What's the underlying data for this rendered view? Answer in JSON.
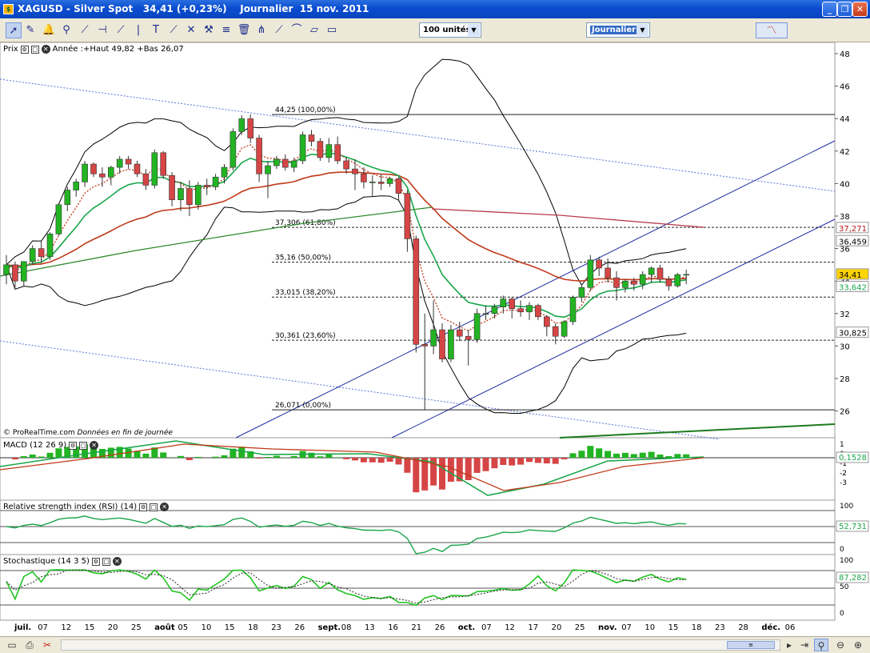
{
  "window": {
    "title_symbol": "XAGUSD - Silver Spot",
    "title_price": "34,41 (+0,23%)",
    "title_period": "Journalier",
    "title_date": "15 nov. 2011",
    "icon": "prorealtime-app-icon",
    "buttons": [
      "minimize",
      "restore",
      "close"
    ]
  },
  "toolbar": {
    "tools": [
      "pointer-icon",
      "ruler-icon",
      "alarm-bell-icon",
      "zoom-icon",
      "trendline-icon",
      "horizontal-line-icon",
      "ray-icon",
      "vertical-line-icon",
      "text-icon",
      "crosshair-icon",
      "arrow-icon",
      "hammer-icon",
      "fibonacci-icon",
      "trash-icon",
      "fibo-fan-icon",
      "regression-channel-icon",
      "fibo-arc-icon",
      "parallel-channel-icon",
      "rectangle-icon"
    ],
    "units_select": "100 unités",
    "period_select": "Journalier",
    "indicator_button_icon": "indicator-chart-icon"
  },
  "price_panel": {
    "label": "Prix",
    "annual_info": "Année :+Haut 49,82 +Bas 26,07",
    "copyright": "© ProRealTime.com",
    "data_note": "Données en fin de journée",
    "y_ticks": [
      "48",
      "46",
      "44",
      "42",
      "40",
      "38",
      "36",
      "34",
      "32",
      "30",
      "28",
      "26"
    ],
    "last_price": "34,41",
    "tags": {
      "red_ma": "37,271",
      "upper_band": "36,459",
      "green_ma": "33,642",
      "lower_band": "30,825"
    },
    "fibo_levels": [
      {
        "label": "44,25 (100,00%)",
        "value": 44.25
      },
      {
        "label": "37,306 (61,80%)",
        "value": 37.306
      },
      {
        "label": "35,16 (50,00%)",
        "value": 35.16
      },
      {
        "label": "33,015 (38,20%)",
        "value": 33.015
      },
      {
        "label": "30,361 (23,60%)",
        "value": 30.361
      },
      {
        "label": "26,071 (0,00%)",
        "value": 26.071
      }
    ],
    "colors": {
      "up": "#22b422",
      "down": "#d64545",
      "ma_red": "#c03a1a",
      "ma_green": "#1aa64a",
      "ma_long_green": "#2e8a2e",
      "ma_long_red": "#b83a4a",
      "channel": "#1c2aa0",
      "band": "#000000"
    }
  },
  "macd_panel": {
    "label": "MACD (12 26 9)",
    "y_ticks": [
      "1",
      "0",
      "-1",
      "-2",
      "-3"
    ],
    "value": "0,1528"
  },
  "rsi_panel": {
    "label": "Relative strength index (RSI) (14)",
    "y_ticks": [
      "100",
      "50",
      "0"
    ],
    "value": "52,731"
  },
  "stoch_panel": {
    "label": "Stochastique (14 3 5)",
    "y_ticks": [
      "100",
      "50",
      "0"
    ],
    "value": "87,282"
  },
  "x_axis": {
    "labels": [
      "juil.",
      "07",
      "12",
      "15",
      "20",
      "25",
      "août",
      "05",
      "10",
      "15",
      "18",
      "23",
      "26",
      "sept.",
      "08",
      "13",
      "16",
      "21",
      "26",
      "oct.",
      "07",
      "12",
      "17",
      "20",
      "25",
      "nov.",
      "07",
      "10",
      "15",
      "18",
      "23",
      "28",
      "déc.",
      "06"
    ],
    "bold": [
      "juil.",
      "août",
      "sept.",
      "oct.",
      "nov.",
      "déc."
    ]
  },
  "chart_data": {
    "type": "candlestick",
    "title": "XAGUSD - Silver Spot",
    "ylim": [
      25,
      49
    ],
    "series": [
      {
        "name": "XAGUSD",
        "ohlc": [
          [
            34.4,
            35.6,
            33.8,
            35.0
          ],
          [
            35.0,
            35.2,
            33.6,
            34.0
          ],
          [
            34.0,
            35.2,
            33.7,
            35.2
          ],
          [
            35.2,
            36.2,
            35.0,
            36.0
          ],
          [
            36.0,
            36.5,
            35.1,
            35.5
          ],
          [
            35.5,
            37.0,
            35.3,
            36.9
          ],
          [
            36.9,
            38.8,
            36.8,
            38.7
          ],
          [
            38.7,
            39.8,
            38.3,
            39.6
          ],
          [
            39.6,
            40.3,
            39.2,
            40.1
          ],
          [
            40.1,
            41.4,
            39.8,
            41.2
          ],
          [
            41.2,
            41.3,
            40.4,
            40.6
          ],
          [
            40.6,
            41.0,
            39.8,
            40.4
          ],
          [
            40.4,
            41.1,
            39.9,
            41.0
          ],
          [
            41.0,
            41.7,
            40.6,
            41.5
          ],
          [
            41.5,
            41.7,
            40.9,
            41.2
          ],
          [
            41.2,
            41.4,
            40.4,
            40.6
          ],
          [
            40.6,
            40.9,
            39.6,
            39.9
          ],
          [
            39.9,
            42.1,
            39.7,
            41.9
          ],
          [
            41.9,
            42.0,
            40.3,
            40.5
          ],
          [
            40.5,
            40.7,
            38.6,
            39.0
          ],
          [
            39.0,
            40.1,
            38.3,
            39.7
          ],
          [
            39.7,
            40.2,
            38.0,
            38.7
          ],
          [
            38.7,
            40.1,
            38.4,
            39.9
          ],
          [
            39.9,
            40.3,
            39.3,
            39.8
          ],
          [
            39.8,
            40.6,
            39.6,
            40.4
          ],
          [
            40.4,
            41.2,
            40.0,
            41.0
          ],
          [
            41.0,
            43.4,
            40.8,
            43.2
          ],
          [
            43.2,
            44.2,
            43.0,
            44.0
          ],
          [
            44.0,
            44.25,
            42.5,
            42.8
          ],
          [
            42.8,
            43.0,
            40.1,
            40.6
          ],
          [
            40.6,
            41.4,
            39.1,
            41.1
          ],
          [
            41.1,
            41.7,
            40.9,
            41.5
          ],
          [
            41.5,
            41.8,
            40.8,
            41.0
          ],
          [
            41.0,
            41.6,
            40.7,
            41.4
          ],
          [
            41.4,
            43.2,
            41.2,
            43.0
          ],
          [
            43.0,
            43.3,
            42.3,
            42.6
          ],
          [
            42.6,
            42.8,
            41.4,
            41.6
          ],
          [
            41.6,
            42.8,
            41.3,
            42.4
          ],
          [
            42.4,
            42.9,
            41.2,
            41.4
          ],
          [
            41.4,
            41.6,
            40.6,
            40.9
          ],
          [
            40.9,
            41.5,
            39.6,
            40.6
          ],
          [
            40.6,
            41.0,
            39.7,
            40.1
          ],
          [
            40.1,
            40.5,
            39.2,
            40.1
          ],
          [
            40.1,
            40.6,
            39.6,
            40.0
          ],
          [
            40.0,
            40.4,
            39.8,
            40.3
          ],
          [
            40.3,
            40.4,
            38.9,
            39.4
          ],
          [
            39.4,
            39.6,
            35.8,
            36.6
          ],
          [
            36.6,
            36.8,
            29.6,
            30.1
          ],
          [
            30.1,
            32.0,
            26.07,
            30.0
          ],
          [
            30.0,
            32.8,
            29.5,
            31.0
          ],
          [
            31.0,
            31.4,
            29.0,
            29.2
          ],
          [
            29.2,
            31.3,
            29.0,
            31.0
          ],
          [
            31.0,
            31.5,
            30.3,
            30.6
          ],
          [
            30.6,
            31.0,
            28.8,
            30.4
          ],
          [
            30.4,
            32.3,
            30.2,
            32.0
          ],
          [
            32.0,
            32.5,
            31.6,
            32.0
          ],
          [
            32.0,
            32.6,
            31.7,
            32.4
          ],
          [
            32.4,
            33.1,
            32.0,
            32.9
          ],
          [
            32.9,
            33.0,
            31.7,
            32.3
          ],
          [
            32.3,
            32.8,
            31.8,
            32.1
          ],
          [
            32.1,
            32.7,
            31.6,
            32.5
          ],
          [
            32.5,
            32.6,
            31.6,
            31.8
          ],
          [
            31.8,
            31.9,
            30.6,
            31.2
          ],
          [
            31.2,
            31.4,
            30.1,
            30.6
          ],
          [
            30.6,
            31.6,
            30.5,
            31.5
          ],
          [
            31.5,
            33.1,
            31.3,
            33.0
          ],
          [
            33.0,
            33.8,
            32.7,
            33.6
          ],
          [
            33.6,
            35.6,
            33.4,
            35.3
          ],
          [
            35.3,
            35.5,
            34.3,
            34.8
          ],
          [
            34.8,
            35.4,
            33.9,
            34.2
          ],
          [
            34.2,
            34.6,
            32.8,
            33.6
          ],
          [
            33.6,
            34.1,
            33.3,
            34.0
          ],
          [
            34.0,
            34.2,
            33.4,
            33.8
          ],
          [
            33.8,
            34.6,
            33.5,
            34.4
          ],
          [
            34.4,
            34.9,
            33.9,
            34.8
          ],
          [
            34.8,
            35.0,
            33.9,
            34.1
          ],
          [
            34.1,
            34.3,
            33.4,
            33.7
          ],
          [
            33.7,
            34.5,
            33.6,
            34.4
          ],
          [
            34.4,
            34.7,
            33.8,
            34.41
          ]
        ]
      }
    ]
  }
}
